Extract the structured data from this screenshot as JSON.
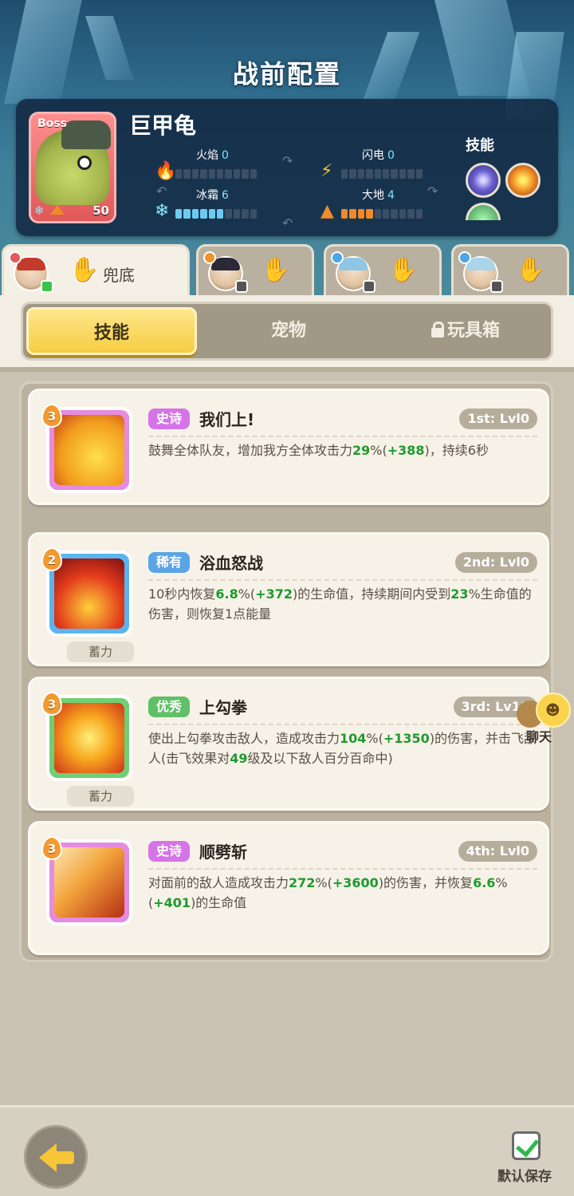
{
  "header": {
    "title": "战前配置"
  },
  "boss": {
    "tag": "Boss",
    "name": "巨甲龟",
    "level": "50",
    "elements": [
      {
        "label": "火焰",
        "value": "0",
        "icon": "fire-icon",
        "filled": 0,
        "segments": 10
      },
      {
        "label": "闪电",
        "value": "0",
        "icon": "lightning-icon",
        "filled": 0,
        "segments": 10
      },
      {
        "label": "冰霜",
        "value": "6",
        "icon": "snowflake-icon",
        "filled": 6,
        "segments": 10
      },
      {
        "label": "大地",
        "value": "4",
        "icon": "earth-icon",
        "filled": 4,
        "segments": 10
      }
    ],
    "skills_label": "技能"
  },
  "hero_tabs": [
    {
      "label": "兜底",
      "active": true
    },
    {
      "label": "",
      "active": false
    },
    {
      "label": "",
      "active": false
    },
    {
      "label": "",
      "active": false
    }
  ],
  "category_tabs": [
    {
      "label": "技能",
      "active": true
    },
    {
      "label": "宠物",
      "active": false
    },
    {
      "label": "玩具箱",
      "active": false,
      "locked": true
    }
  ],
  "skills": [
    {
      "rank": "3",
      "rarity": "史诗",
      "rarity_color": "#d574e6",
      "name": "我们上!",
      "slot": "1st: Lvl0",
      "charge": "",
      "desc_parts": [
        "鼓舞全体队友，增加我方全体攻击力",
        "29",
        "%(",
        "+388",
        ")，持续6秒"
      ]
    },
    {
      "rank": "2",
      "rarity": "稀有",
      "rarity_color": "#5aa5e6",
      "name": "浴血怒战",
      "slot": "2nd: Lvl0",
      "charge": "蓄力",
      "desc_parts": [
        "10秒内恢复",
        "6.8",
        "%(",
        "+372",
        ")的生命值，持续期间内受到",
        "23",
        "%生命值的伤害，则恢复1点能量"
      ]
    },
    {
      "rank": "3",
      "rarity": "优秀",
      "rarity_color": "#5fc067",
      "name": "上勾拳",
      "slot": "3rd: Lv11",
      "charge": "蓄力",
      "desc_parts": [
        "使出上勾拳攻击敌人，造成攻击力",
        "104",
        "%(",
        "+1350",
        ")的伤害，并击飞敌人(击飞效果对",
        "49",
        "级及以下敌人百分百命中)"
      ]
    },
    {
      "rank": "3",
      "rarity": "史诗",
      "rarity_color": "#d574e6",
      "name": "顺劈斩",
      "slot": "4th: Lvl0",
      "charge": "",
      "desc_parts": [
        "对面前的敌人造成攻击力",
        "272",
        "%(",
        "+3600",
        ")的伤害，并恢复",
        "6.6",
        "%(",
        "+401",
        ")的生命值"
      ]
    }
  ],
  "chat": {
    "label": "聊天"
  },
  "footer": {
    "save_label": "默认保存"
  }
}
